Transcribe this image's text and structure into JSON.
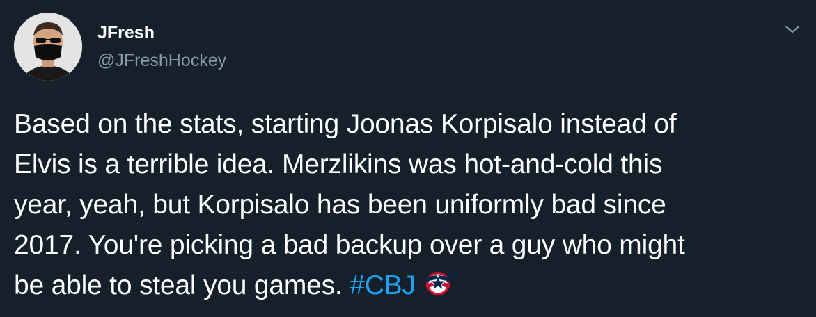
{
  "author": {
    "display_name": "JFresh",
    "handle": "@JFreshHockey"
  },
  "tweet": {
    "text": "Based on the stats, starting Joonas Korpisalo instead of\nElvis is a terrible idea. Merzlikins was hot-and-cold this\nyear, yeah, but Korpisalo has been uniformly bad since\n2017. You're picking a bad backup over a guy who might\nbe able to steal you games. ",
    "hashtag": "#CBJ",
    "hashtag_emoji": "columbus-blue-jackets-logo"
  },
  "icons": {
    "caret": "chevron-down-icon",
    "avatar": "avatar"
  },
  "colors": {
    "background": "#15202b",
    "text": "#ffffff",
    "secondary": "#8899a6",
    "link": "#1da1f2"
  }
}
